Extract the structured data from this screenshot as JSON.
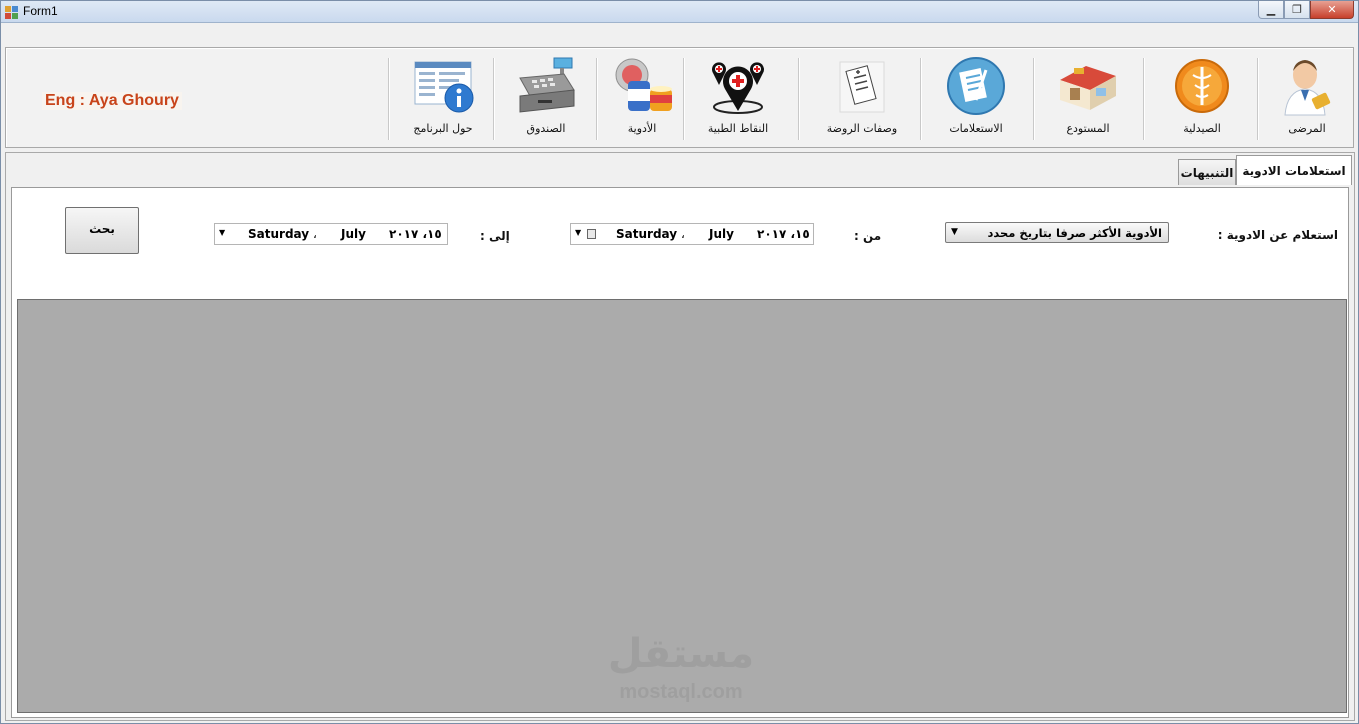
{
  "window": {
    "title": "Form1"
  },
  "toolbar": {
    "credit": "Eng : Aya Ghoury",
    "items": [
      {
        "label": "المرضى",
        "icon": "doctor-icon"
      },
      {
        "label": "الصيدلية",
        "icon": "caduceus-icon"
      },
      {
        "label": "المستودع",
        "icon": "warehouse-icon"
      },
      {
        "label": "الاستعلامات",
        "icon": "inquiry-notes-icon"
      },
      {
        "label": "وصفات الروضة",
        "icon": "prescription-icon"
      },
      {
        "label": "النقاط الطبية",
        "icon": "medical-points-icon"
      },
      {
        "label": "الأدوية",
        "icon": "medicine-icon"
      },
      {
        "label": "الصندوق",
        "icon": "cash-register-icon"
      },
      {
        "label": "حول البرنامج",
        "icon": "about-info-icon"
      }
    ]
  },
  "tabs": {
    "active": "استعلامات الادوية",
    "inactive": "التنبيهات"
  },
  "query": {
    "label": "استعلام عن الادوية :",
    "selected": "الأدوية الأكثر صرفا بتاريخ محدد",
    "from_label": "من :",
    "to_label": "إلى :",
    "from_date": {
      "day": "Saturday",
      "sep": "،",
      "month": "July",
      "date": "١٥، ٢٠١٧"
    },
    "to_date": {
      "day": "Saturday",
      "sep": "،",
      "month": "July",
      "date": "١٥، ٢٠١٧"
    },
    "search_label": "بحث"
  },
  "watermark": {
    "ar": "مستقل",
    "en": "mostaql.com"
  }
}
